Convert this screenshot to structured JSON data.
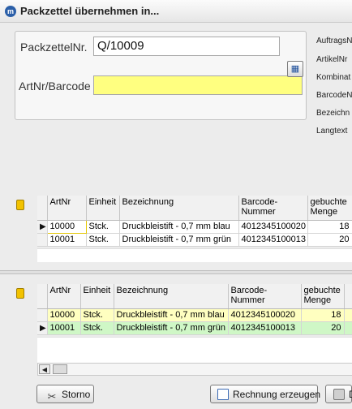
{
  "window": {
    "title": "Packzettel übernehmen in...",
    "icon": "app-icon"
  },
  "form": {
    "packzettel_label": "PackzettelNr.",
    "packzettel_value": "Q/10009",
    "artnr_label": "ArtNr/Barcode",
    "artnr_value": "",
    "lookup_icon": "lookup-icon"
  },
  "side_labels": [
    "AuftragsN",
    "ArtikelNr",
    "Kombinat",
    "BarcodeN",
    "Bezeichn",
    "Langtext"
  ],
  "top_grid": {
    "headers": [
      "ArtNr",
      "Einheit",
      "Bezeichnung",
      "Barcode-\nNummer",
      "gebuchte\nMenge"
    ],
    "rows": [
      {
        "artnr": "10000",
        "einheit": "Stck.",
        "bezeichnung": "Druckbleistift - 0,7 mm  blau",
        "barcode": "4012345100020",
        "menge": "18"
      },
      {
        "artnr": "10001",
        "einheit": "Stck.",
        "bezeichnung": "Druckbleistift - 0,7 mm  grün",
        "barcode": "4012345100013",
        "menge": "20"
      }
    ]
  },
  "bottom_grid": {
    "headers": [
      "ArtNr",
      "Einheit",
      "Bezeichnung",
      "Barcode-\nNummer",
      "gebuchte\nMenge"
    ],
    "rows": [
      {
        "artnr": "10000",
        "einheit": "Stck.",
        "bezeichnung": "Druckbleistift - 0,7 mm  blau",
        "barcode": "4012345100020",
        "menge": "18"
      },
      {
        "artnr": "10001",
        "einheit": "Stck.",
        "bezeichnung": "Druckbleistift - 0,7 mm  grün",
        "barcode": "4012345100013",
        "menge": "20"
      }
    ],
    "row_colors": [
      "#ffffc0",
      "#cff7c6"
    ]
  },
  "footer": {
    "storno_label": "Storno",
    "rechnung_label": "Rechnung erzeugen",
    "third_label": "D"
  },
  "colors": {
    "input_highlight": "#ffff80",
    "folder": "#f2c200"
  }
}
